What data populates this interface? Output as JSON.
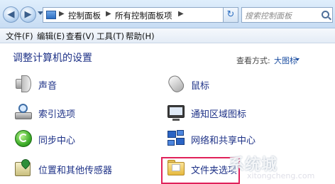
{
  "address_bar": {
    "breadcrumbs": [
      "控制面板",
      "所有控制面板项"
    ],
    "search_placeholder": "搜索控制面板"
  },
  "menu": {
    "items": [
      "文件(F)",
      "编辑(E)",
      "查看(V)",
      "工具(T)",
      "帮助(H)"
    ]
  },
  "main": {
    "title": "调整计算机的设置",
    "view_by_label": "查看方式:",
    "view_by_value": "大图标"
  },
  "items": [
    {
      "label": "声音",
      "icon": "speaker-icon"
    },
    {
      "label": "鼠标",
      "icon": "mouse-icon"
    },
    {
      "label": "索引选项",
      "icon": "indexing-icon"
    },
    {
      "label": "通知区域图标",
      "icon": "notification-area-icon"
    },
    {
      "label": "同步中心",
      "icon": "sync-center-icon"
    },
    {
      "label": "网络和共享中心",
      "icon": "network-icon"
    },
    {
      "label": "位置和其他传感器",
      "icon": "location-sensor-icon"
    },
    {
      "label": "文件夹选项",
      "icon": "folder-options-icon"
    }
  ],
  "highlight_color": "#e0215a",
  "watermark": {
    "text": "系统城",
    "url": "xitongcheng.com"
  }
}
